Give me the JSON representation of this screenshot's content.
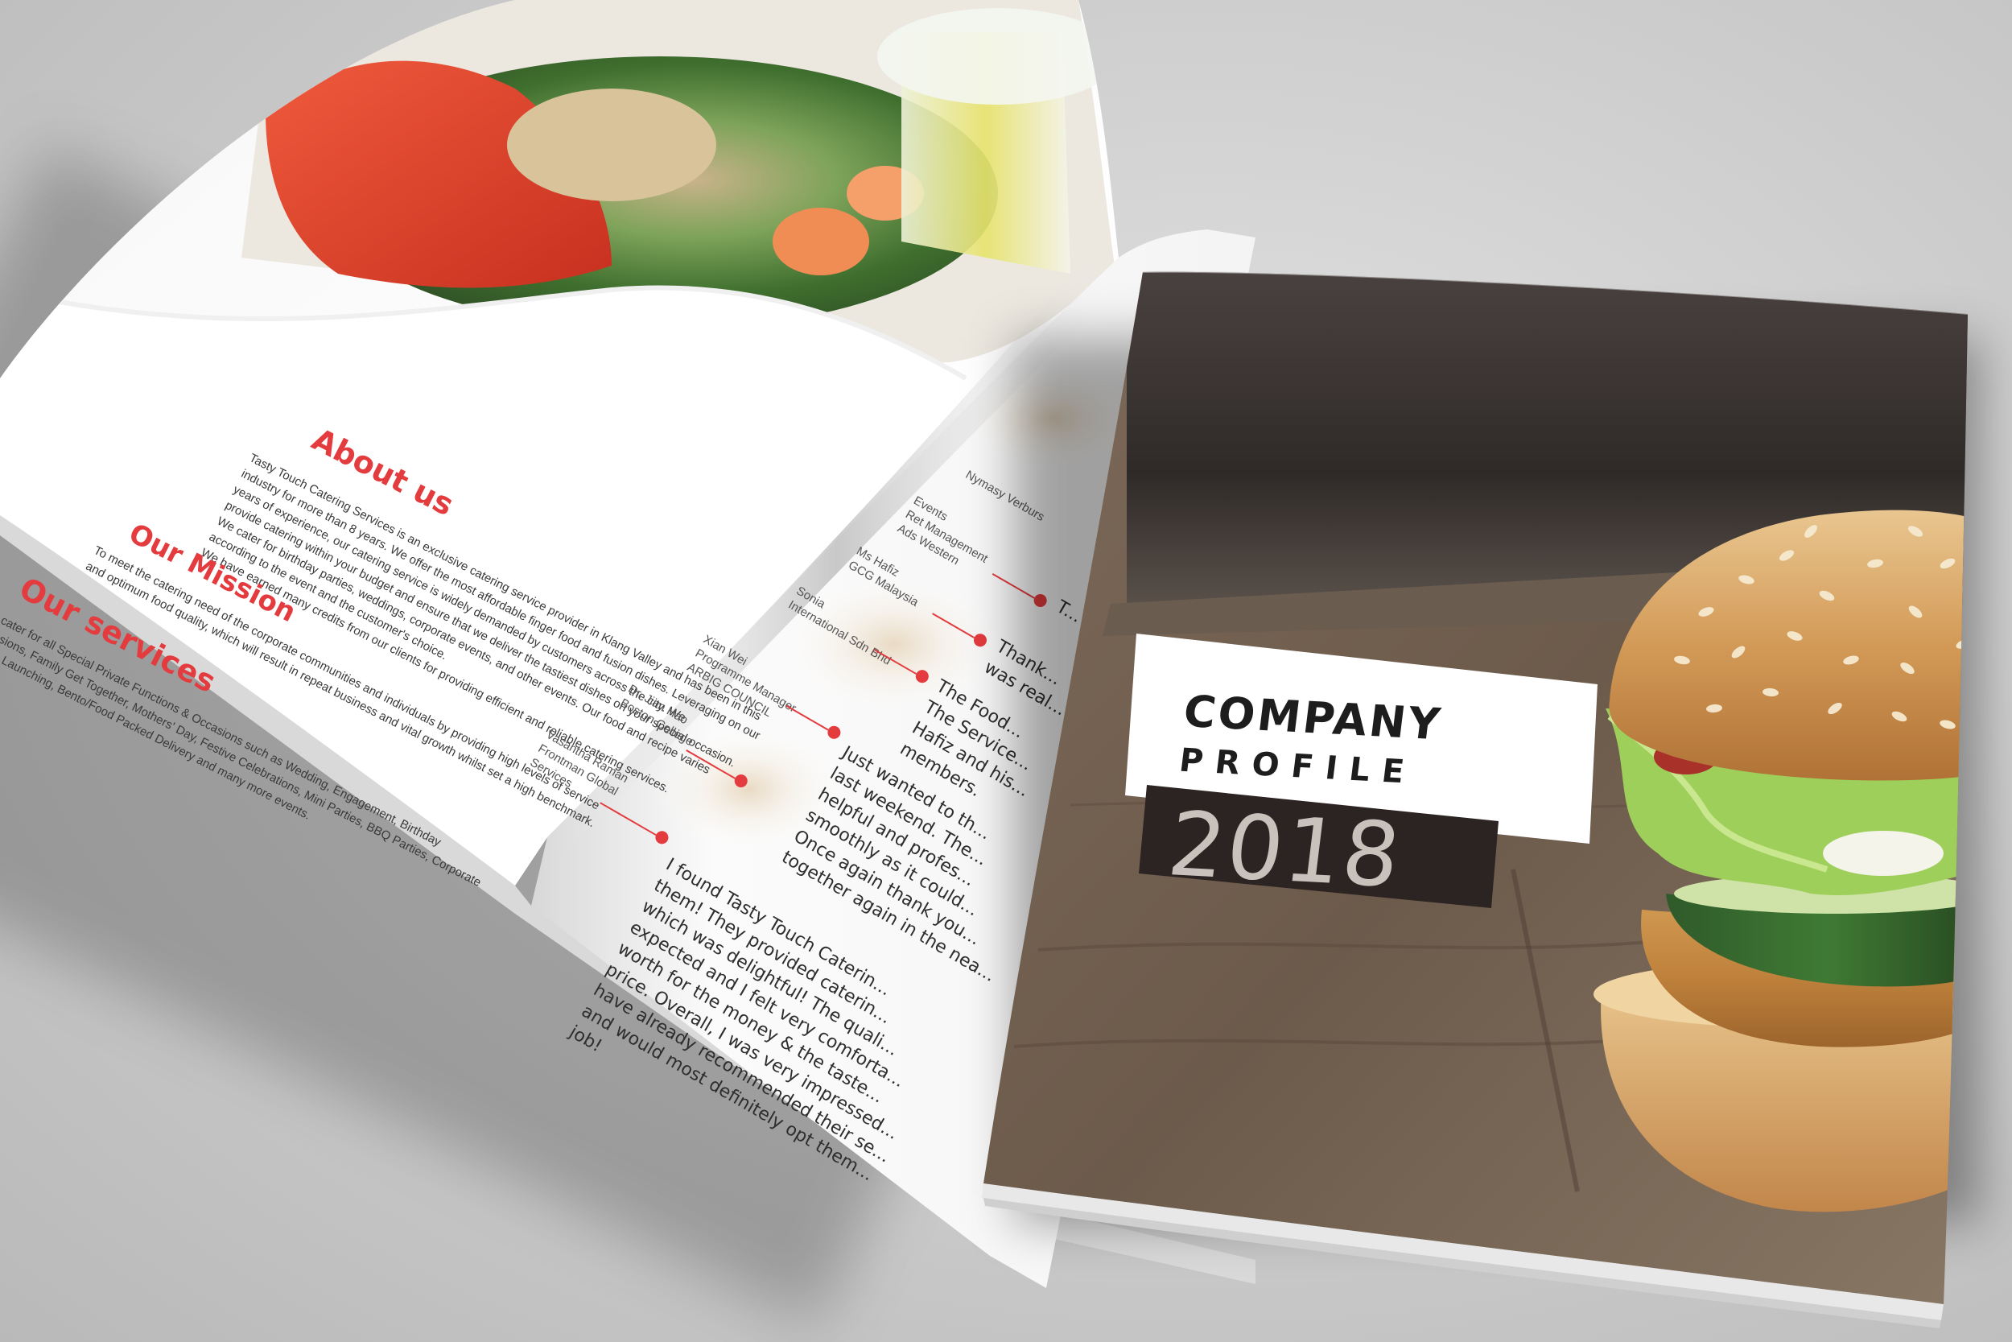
{
  "scene": {
    "background_color": "#cfcfcf",
    "accent_color": "#e33b3e"
  },
  "open_magazine": {
    "left_page": {
      "about_heading": "About us",
      "about_body": [
        "Tasty Touch Catering Services is an exclusive catering service provider in Klang Valley and has been in this",
        "industry for more than 8 years. We offer the most affordable finger food and fusion dishes. Leveraging on our",
        "years of experience, our catering service is widely demanded by customers across the city. We",
        "provide catering within your budget and ensure that we deliver the tastiest dishes on your special occasion.",
        "We cater for birthday parties, weddings, corporate events, and other events. Our food and recipe varies",
        "according to the event and the customer's choice.",
        "We have earned many credits from our clients for providing efficient and reliable catering services."
      ],
      "mission_heading": "Our Mission",
      "mission_body": [
        "To meet the catering need of the corporate communities and individuals by providing high levels of service",
        "and optimum food quality, which will result in repeat business and vital growth whilst set a high benchmark."
      ],
      "services_heading": "Our services",
      "services_body": [
        "We cater for all Special Private Functions & Occasions such as Wedding, Engagement, Birthday",
        "Occasions, Family Get Together, Mothers' Day, Festive Celebrations, Mini Parties, BBQ Parties, Corporate",
        "Events Launching, Bento/Food Packed Delivery and many more events."
      ]
    },
    "right_page": {
      "clients": [
        "Nymasy Verburs",
        "Events\nRet Management\nAds Western",
        "Ms Hafiz\nGCG Malaysia",
        "Sonia\nInternational Sdn Bhd",
        "Xian Wei\nProgramme Manager\nARBIG COUNCIL",
        "Dr. Jian Hao\nBoston College",
        "Vasantha Raman\nFrontman Global\nServices"
      ],
      "testimonials": [
        "T...",
        "Thank...\nwas real...",
        "The Food...\nThe Service...\nHafiz and his...\nmembers.",
        "Just wanted to th...\nlast weekend. The...\nhelpful and profes...\nsmoothly as it could...\nOnce again thank you...\ntogether again in the nea...",
        "I found Tasty Touch Caterin...\nthem! They provided caterin...\nwhich was delightful! The quali...\nexpected and I felt very comforta...\nworth for the money & the taste...\nprice. Overall, I was very impressed...\nhave already recommended their se...\nand would most definitely opt them...\njob!"
      ]
    }
  },
  "cover": {
    "title_line1": "COMPANY",
    "title_line2": "PROFILE",
    "year": "2018"
  }
}
